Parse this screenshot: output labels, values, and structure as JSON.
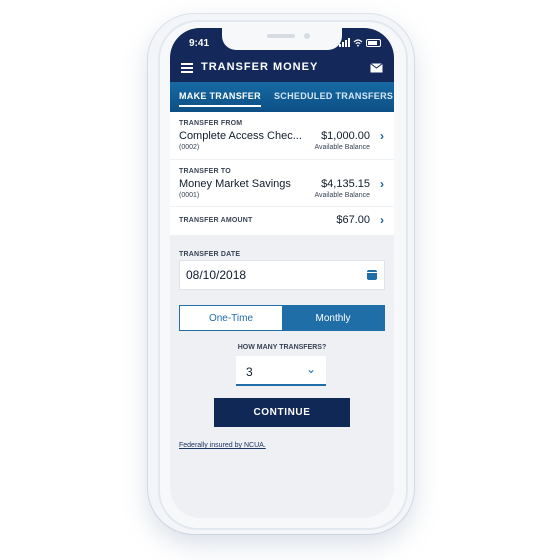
{
  "status": {
    "time": "9:41"
  },
  "header": {
    "title": "TRANSFER MONEY",
    "menu_icon": "menu-icon",
    "mail_icon": "mail-icon"
  },
  "tabs": [
    {
      "label": "MAKE TRANSFER",
      "active": true
    },
    {
      "label": "SCHEDULED TRANSFERS",
      "active": false
    }
  ],
  "transfer_from": {
    "label": "TRANSFER FROM",
    "account": "Complete Access Chec...",
    "account_number": "(0002)",
    "amount": "$1,000.00",
    "balance_label": "Available Balance"
  },
  "transfer_to": {
    "label": "TRANSFER TO",
    "account": "Money Market Savings",
    "account_number": "(0001)",
    "amount": "$4,135.15",
    "balance_label": "Available Balance"
  },
  "transfer_amount": {
    "label": "TRANSFER AMOUNT",
    "value": "$67.00"
  },
  "transfer_date": {
    "label": "TRANSFER DATE",
    "value": "08/10/2018",
    "icon": "calendar-icon"
  },
  "frequency": {
    "options": [
      "One-Time",
      "Monthly"
    ],
    "selected": "Monthly"
  },
  "transfers": {
    "label": "HOW MANY TRANSFERS?",
    "value": "3",
    "icon": "chevron-down-icon"
  },
  "continue": {
    "label": "CONTINUE"
  },
  "footer": {
    "link": "Federally insured by NCUA."
  },
  "colors": {
    "navy": "#14295a",
    "blue": "#1f6ea8",
    "background": "#eef0f3"
  }
}
